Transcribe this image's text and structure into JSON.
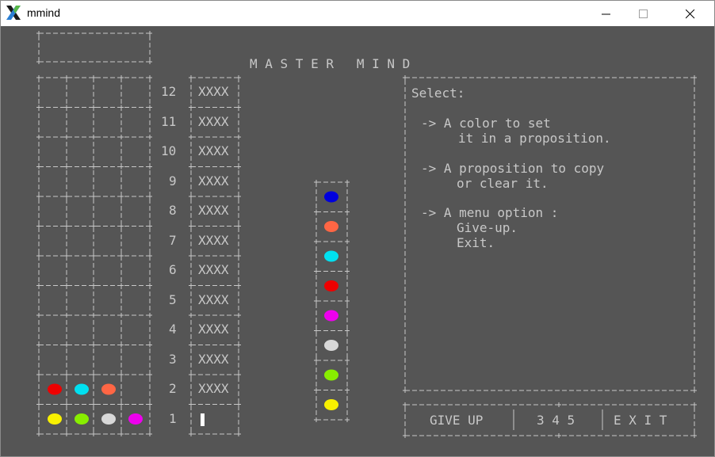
{
  "window": {
    "title": "mmind"
  },
  "game": {
    "title": "M A S T E R   M I N D",
    "row_numbers": [
      "12",
      "11",
      "10",
      "9",
      "8",
      "7",
      "6",
      "5",
      "4",
      "3",
      "2",
      "1"
    ],
    "hidden_code": "XXXX",
    "rows": [
      {
        "number": "2",
        "pegs": [
          "red",
          "cyan",
          "orange",
          ""
        ]
      },
      {
        "number": "1",
        "pegs": [
          "yellow",
          "green",
          "white",
          "magenta"
        ]
      }
    ],
    "palette": [
      "blue",
      "orange",
      "cyan",
      "red",
      "magenta",
      "white",
      "green",
      "yellow"
    ],
    "colors": {
      "blue": "#0000dd",
      "orange": "#ff6644",
      "cyan": "#00e0f0",
      "red": "#ee0000",
      "magenta": "#ee00ee",
      "white": "#d8d8d8",
      "green": "#88ee00",
      "yellow": "#f8f000",
      "text": "#c8c8c8",
      "background": "#555555"
    }
  },
  "help": {
    "select": "Select:",
    "item1_line1": "-> A color to set",
    "item1_line2": "it in a proposition.",
    "item2_line1": "-> A proposition to copy",
    "item2_line2": "or clear it.",
    "item3_line1": "-> A menu option :",
    "item3_line2": "Give-up.",
    "item3_line3": "Exit."
  },
  "menu": {
    "give_up": "GIVE UP",
    "code_length": "3 4 5",
    "exit": "E X I T"
  }
}
